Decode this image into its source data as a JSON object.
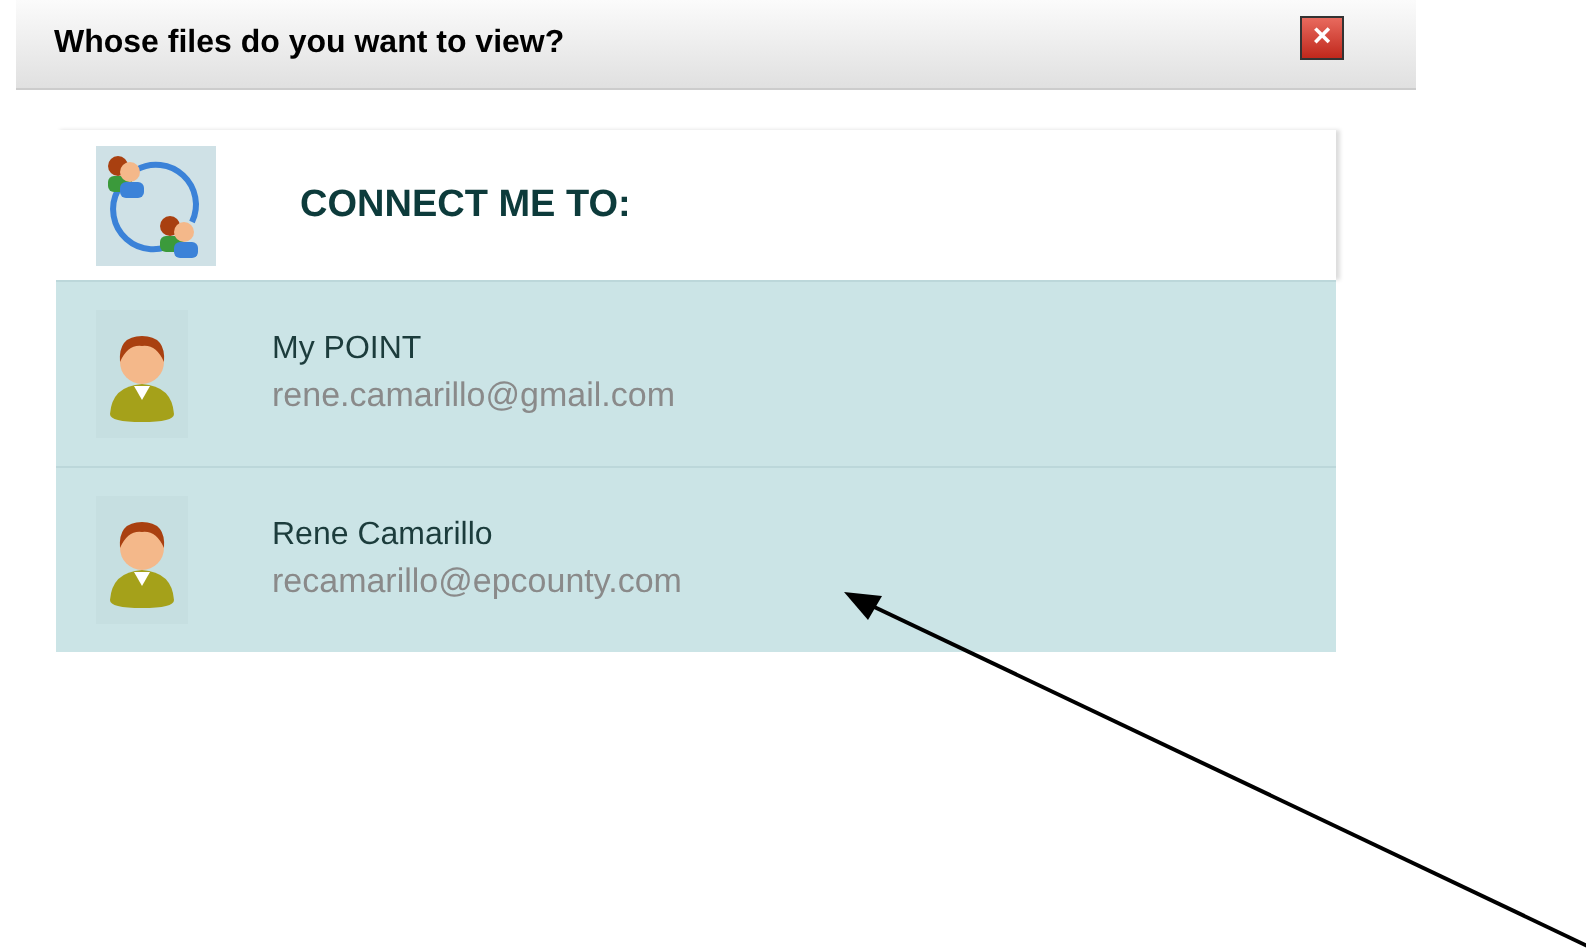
{
  "window": {
    "title": "Whose files do you want to view?",
    "close": "×"
  },
  "header": {
    "title": "CONNECT ME TO:"
  },
  "accounts": [
    {
      "name": "My POINT",
      "email": "rene.camarillo@gmail.com"
    },
    {
      "name": "Rene Camarillo",
      "email": "recamarillo@epcounty.com"
    }
  ]
}
